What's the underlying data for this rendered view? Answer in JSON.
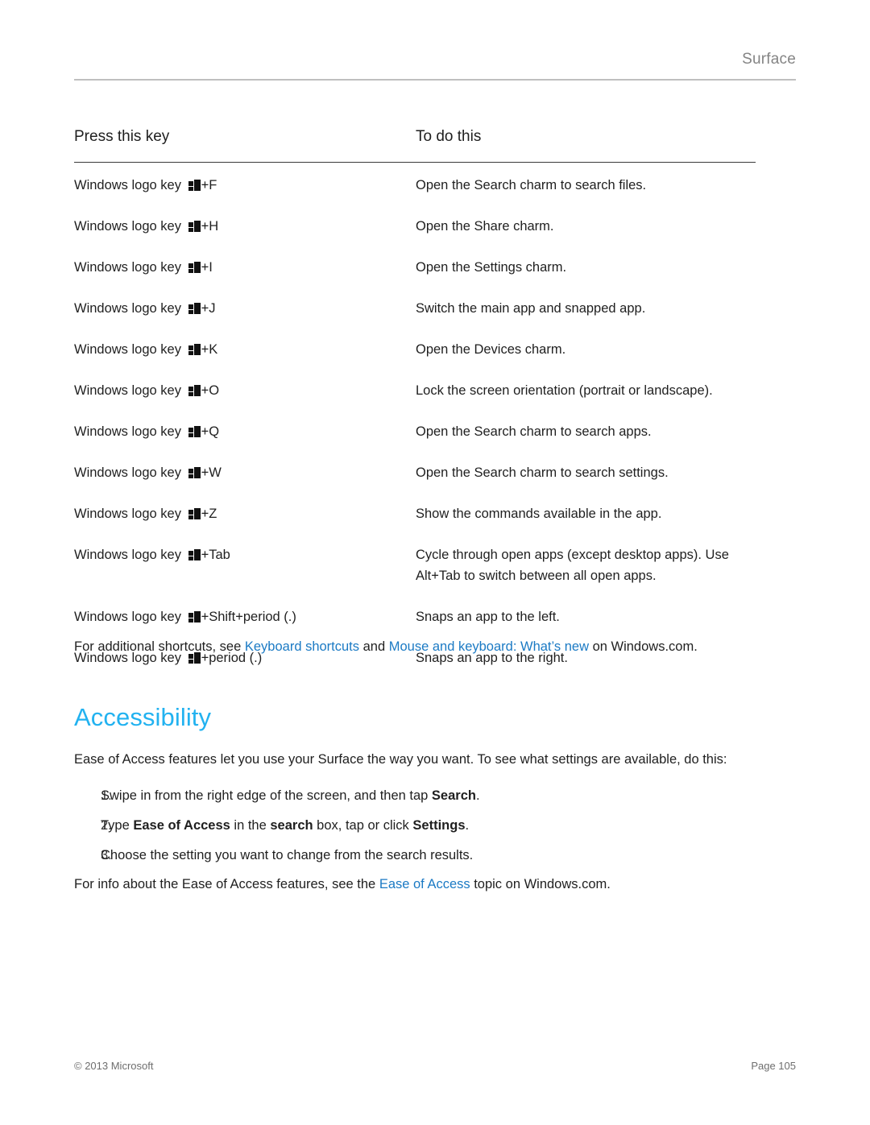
{
  "header": {
    "title": "Surface"
  },
  "table": {
    "columns": [
      "Press this key",
      "To do this"
    ],
    "rows": [
      {
        "key_prefix": "Windows logo key",
        "key_suffix": "+F",
        "description": "Open the Search charm to search files."
      },
      {
        "key_prefix": "Windows logo key",
        "key_suffix": "+H",
        "description": "Open the Share charm."
      },
      {
        "key_prefix": "Windows logo key",
        "key_suffix": "+I",
        "description": "Open the Settings charm."
      },
      {
        "key_prefix": "Windows logo key",
        "key_suffix": "+J",
        "description": "Switch the main app and snapped app."
      },
      {
        "key_prefix": "Windows logo key",
        "key_suffix": "+K",
        "description": "Open the Devices charm."
      },
      {
        "key_prefix": "Windows logo key",
        "key_suffix": "+O",
        "description": "Lock the screen orientation (portrait or landscape)."
      },
      {
        "key_prefix": "Windows logo key",
        "key_suffix": "+Q",
        "description": "Open the Search charm to search apps."
      },
      {
        "key_prefix": "Windows logo key",
        "key_suffix": "+W",
        "description": "Open the Search charm to search settings."
      },
      {
        "key_prefix": "Windows logo key",
        "key_suffix": "+Z",
        "description": "Show the commands available in the app."
      },
      {
        "key_prefix": "Windows logo key",
        "key_suffix": "+Tab",
        "description": "Cycle through open apps (except desktop apps). Use Alt+Tab to switch between all open apps."
      },
      {
        "key_prefix": "Windows logo key",
        "key_suffix": "+Shift+period (.)",
        "description": "Snaps an app to the left."
      },
      {
        "key_prefix": "Windows logo key",
        "key_suffix": "+period (.)",
        "description": "Snaps an app to the right."
      }
    ]
  },
  "shortcuts_note": {
    "lead": "For additional shortcuts, see ",
    "link1": "Keyboard shortcuts",
    "middle": " and ",
    "link2": "Mouse and keyboard: What’s new",
    "tail": " on Windows.com."
  },
  "section": {
    "heading": "Accessibility",
    "intro": "Ease of Access features let you use your Surface the way you want. To see what settings are available, do this:",
    "steps": [
      {
        "number": "1.",
        "part1": "Swipe in from the right edge of the screen, and then tap ",
        "bold1": "Search",
        "part2": ".",
        "bold2": "",
        "part3": "",
        "bold3": "",
        "part4": ""
      },
      {
        "number": "2.",
        "part1": "Type ",
        "bold1": "Ease of Access",
        "part2": " in the ",
        "bold2": "search",
        "part3": " box, tap or click ",
        "bold3": "Settings",
        "part4": "."
      },
      {
        "number": "3.",
        "part1": "Choose the setting you want to change from the search results.",
        "bold1": "",
        "part2": "",
        "bold2": "",
        "part3": "",
        "bold3": "",
        "part4": ""
      }
    ],
    "outro": {
      "lead": "For info about the Ease of Access features, see the ",
      "link": "Ease of Access",
      "tail": " topic on Windows.com."
    }
  },
  "footer": {
    "copyright": "© 2013 Microsoft",
    "page": "Page 105"
  },
  "colors": {
    "link": "#1b7ac4",
    "heading": "#22b2f0",
    "header_text": "#848484",
    "rule": "#bfbfbf",
    "table_rule": "#3a3a3a"
  }
}
